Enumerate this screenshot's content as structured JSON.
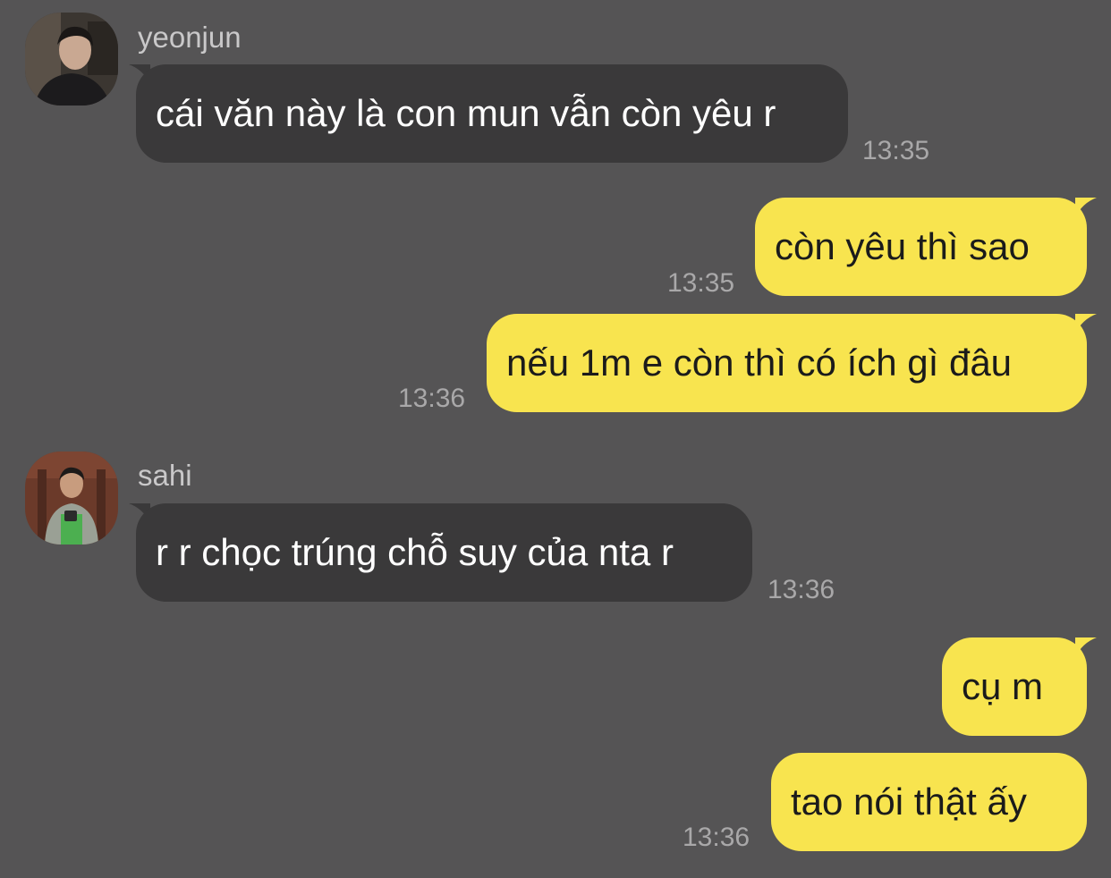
{
  "colors": {
    "background": "#555455",
    "incoming_bubble": "#3a393a",
    "outgoing_bubble": "#f8e44f",
    "timestamp": "#a9a8a9",
    "sender_name": "#c9c8c9"
  },
  "messages": [
    {
      "direction": "incoming",
      "sender": "yeonjun",
      "avatar_icon": "profile-photo-icon",
      "text": "cái văn này là con mun vẫn còn yêu r",
      "time": "13:35"
    },
    {
      "direction": "outgoing",
      "text": "còn yêu thì sao",
      "time": "13:35"
    },
    {
      "direction": "outgoing",
      "text": "nếu 1m e còn thì có ích gì đâu",
      "time": "13:36"
    },
    {
      "direction": "incoming",
      "sender": "sahi",
      "avatar_icon": "profile-photo-icon",
      "text": "r r chọc trúng chỗ suy của nta r",
      "time": "13:36"
    },
    {
      "direction": "outgoing",
      "text": "cụ m",
      "time": ""
    },
    {
      "direction": "outgoing",
      "text": "tao nói thật ấy",
      "time": "13:36"
    }
  ]
}
